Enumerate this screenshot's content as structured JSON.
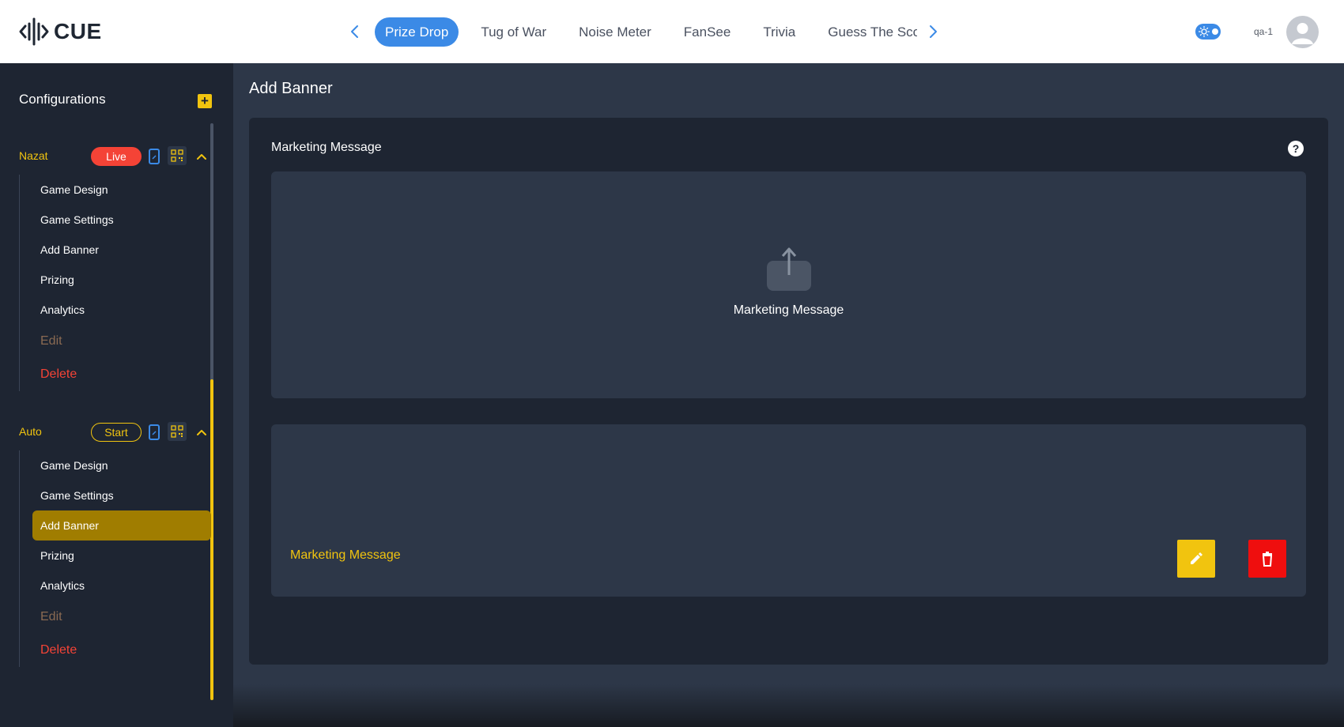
{
  "app": {
    "logo_text": "CUE"
  },
  "topnav": {
    "tabs": [
      {
        "label": "Prize Drop",
        "active": true
      },
      {
        "label": "Tug of War"
      },
      {
        "label": "Noise Meter"
      },
      {
        "label": "FanSee"
      },
      {
        "label": "Trivia"
      },
      {
        "label": "Guess The Sco"
      }
    ],
    "prev_icon": "chevron-left-icon",
    "next_icon": "chevron-right-icon"
  },
  "user": {
    "name": "qa-1",
    "theme_toggle": "sun-icon"
  },
  "sidebar": {
    "title": "Configurations",
    "add_label": "+",
    "groups": [
      {
        "name": "Nazat",
        "status": "Live",
        "items": [
          "Game Design",
          "Game Settings",
          "Add Banner",
          "Prizing",
          "Analytics"
        ],
        "edit": "Edit",
        "delete": "Delete"
      },
      {
        "name": "Auto",
        "status": "Start",
        "items": [
          "Game Design",
          "Game Settings",
          "Add Banner",
          "Prizing",
          "Analytics"
        ],
        "active_item": "Add Banner",
        "edit": "Edit",
        "delete": "Delete"
      }
    ]
  },
  "main": {
    "title": "Add Banner",
    "card": {
      "label": "Marketing Message",
      "help": "?",
      "dropzone_text": "Marketing Message",
      "banner_name": "Marketing Message"
    }
  },
  "colors": {
    "accent_blue": "#3b8ae6",
    "accent_yellow": "#f1c40f",
    "live_red": "#f44336",
    "delete_red": "#ef0e0e",
    "panel_dark": "#1e2532",
    "panel": "#2d3748"
  }
}
